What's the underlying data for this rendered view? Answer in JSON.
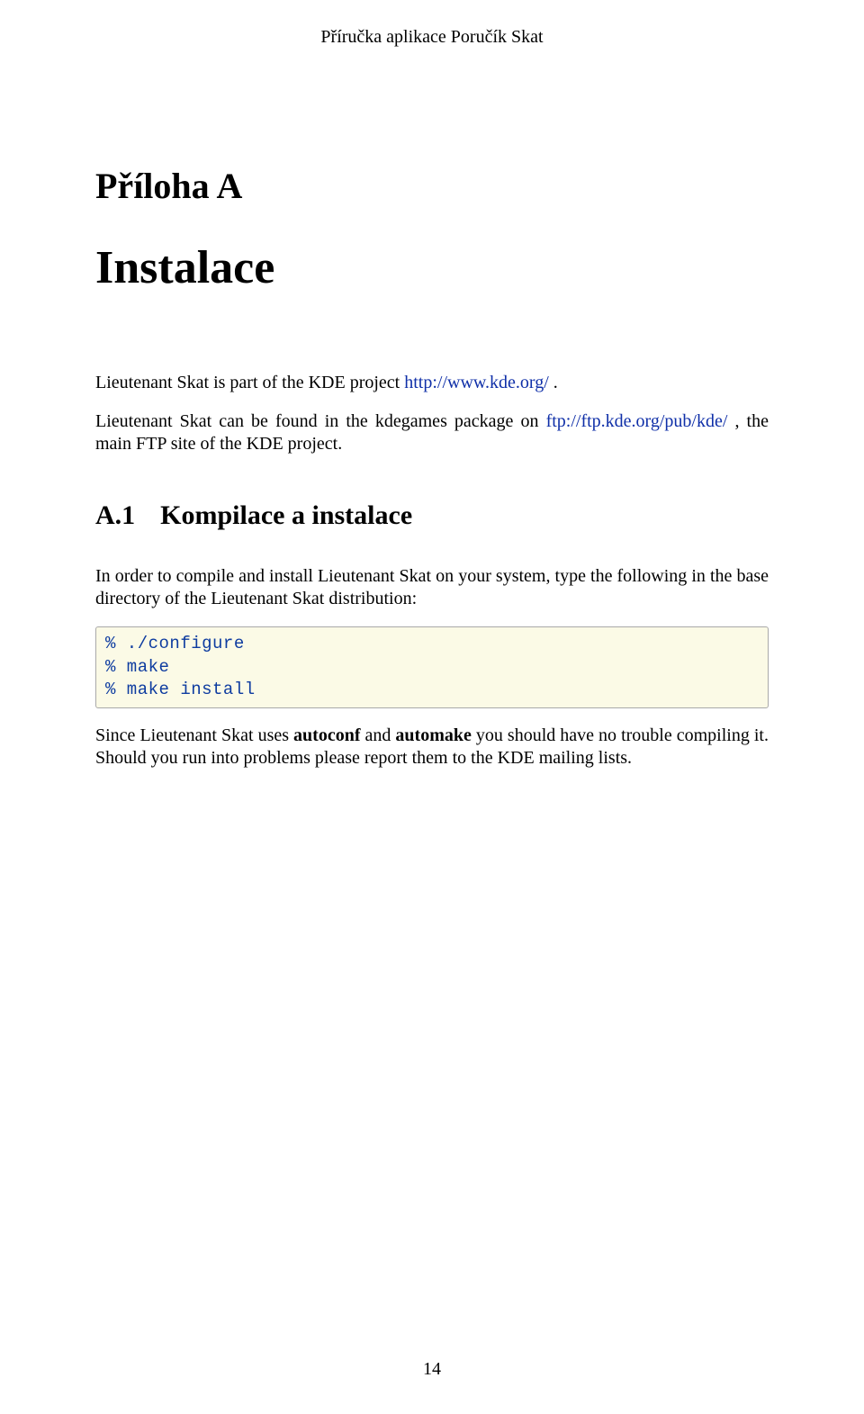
{
  "header": {
    "running": "Příručka aplikace Poručík Skat"
  },
  "appendix": {
    "label": "Příloha A",
    "title": "Instalace"
  },
  "intro": {
    "p1a": "Lieutenant Skat is part of the KDE project ",
    "link1": "http://www.kde.org/",
    "p1b": " .",
    "p2a": "Lieutenant Skat can be found in the kdegames package on ",
    "link2": "ftp://ftp.kde.org/pub/kde/",
    "p2b": " , the main FTP site of the KDE project."
  },
  "section": {
    "num": "A.1",
    "title": "Kompilace a instalace",
    "p1": "In order to compile and install Lieutenant Skat on your system, type the following in the base directory of the Lieutenant Skat distribution:",
    "code": "% ./configure\n% make\n% make install",
    "p2a": "Since Lieutenant Skat uses ",
    "b1": "autoconf",
    "p2b": " and ",
    "b2": "automake",
    "p2c": " you should have no trouble compiling it. Should you run into problems please report them to the KDE mailing lists."
  },
  "page_number": "14"
}
